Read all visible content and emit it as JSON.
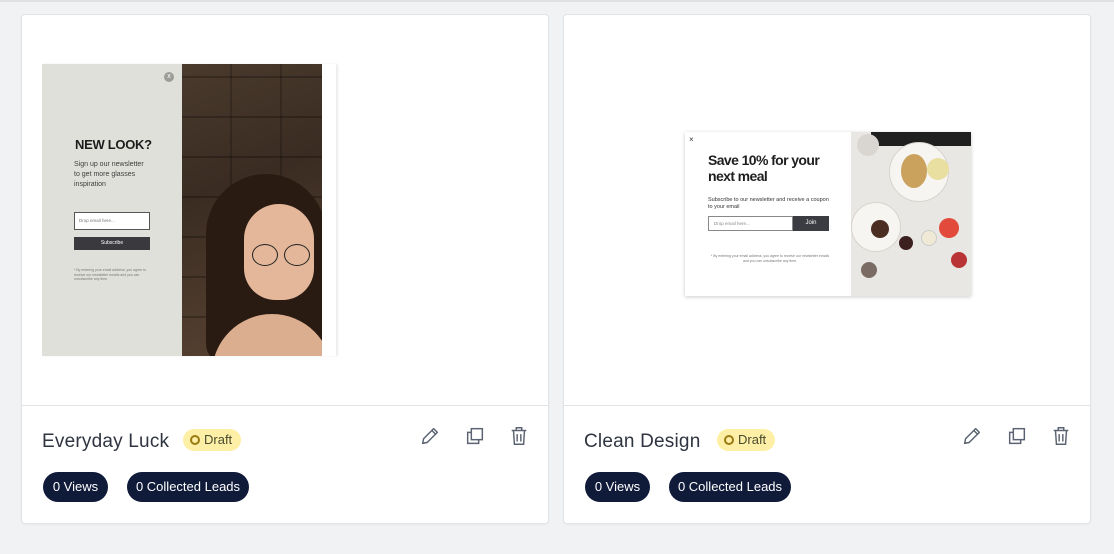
{
  "cards": [
    {
      "title": "Everyday Luck",
      "status": "Draft",
      "views": "0 Views",
      "leads": "0 Collected Leads",
      "preview": {
        "close_symbol": "x",
        "headline": "NEW LOOK?",
        "subtext": "Sign up our newsletter to get more glasses inspiration",
        "input_placeholder": "Drop email here...",
        "button": "Subscribe",
        "fine_print": "* By entering your email address, you agree to receive our newsletter emails and you can unsubscribe any time."
      }
    },
    {
      "title": "Clean Design",
      "status": "Draft",
      "views": "0 Views",
      "leads": "0 Collected Leads",
      "preview": {
        "close_symbol": "×",
        "headline": "Save 10% for your next meal",
        "subtext": "Subscribe to our newsletter and receive a coupon to your email",
        "input_placeholder": "Drop email here...",
        "button": "Join",
        "fine_print": "* By entering your email address, you agree to receive our newsletter emails and you can unsubscribe any time."
      }
    }
  ],
  "icons": {
    "edit": "pencil-icon",
    "duplicate": "copy-icon",
    "delete": "trash-icon"
  },
  "colors": {
    "page_bg": "#f1f2f4",
    "pill_bg": "#101b3a",
    "draft_badge_bg": "#fdf0a6",
    "icon": "#5b6372"
  }
}
